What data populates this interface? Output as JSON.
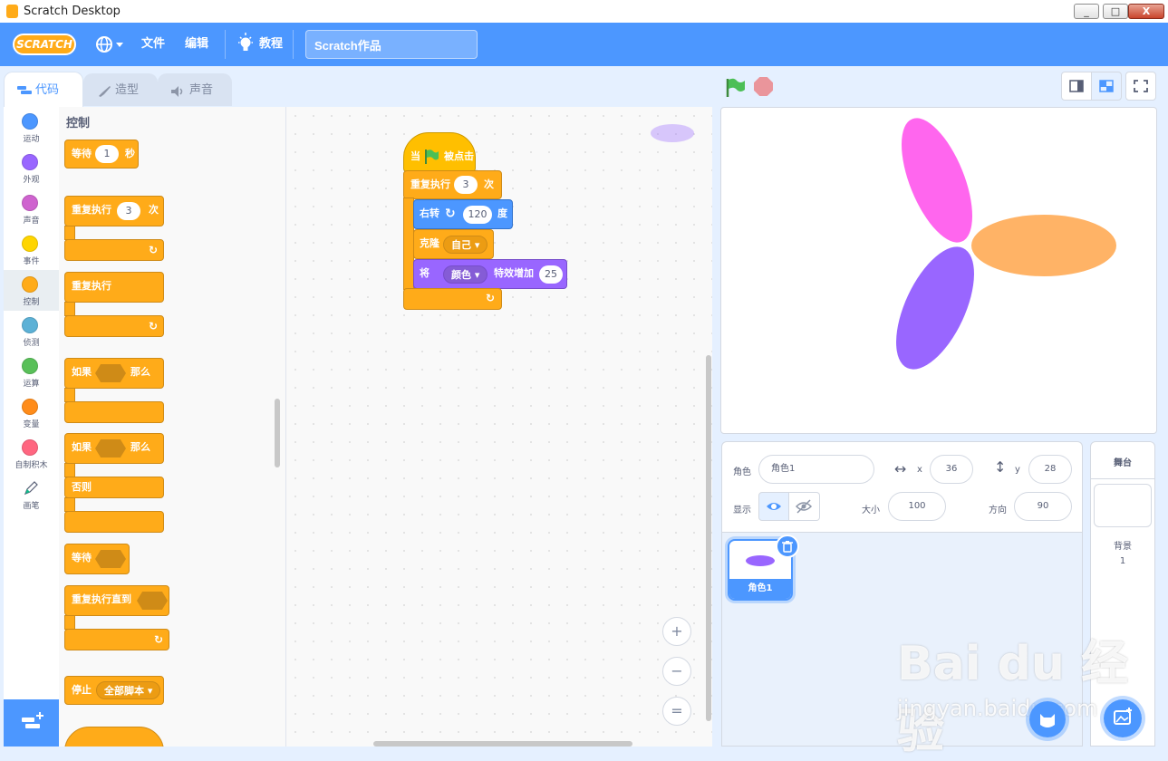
{
  "window": {
    "title": "Scratch Desktop",
    "min": "_",
    "max": "□",
    "close": "X"
  },
  "menubar": {
    "logo": "SCRATCH",
    "file": "文件",
    "edit": "编辑",
    "tutorials": "教程",
    "project_title": "Scratch作品"
  },
  "tabs": {
    "code": "代码",
    "costumes": "造型",
    "sounds": "声音"
  },
  "categories": [
    {
      "label": "运动",
      "color": "#4c97ff"
    },
    {
      "label": "外观",
      "color": "#9966ff"
    },
    {
      "label": "声音",
      "color": "#cf63cf"
    },
    {
      "label": "事件",
      "color": "#ffd500"
    },
    {
      "label": "控制",
      "color": "#ffab19"
    },
    {
      "label": "侦测",
      "color": "#5cb1d6"
    },
    {
      "label": "运算",
      "color": "#59c059"
    },
    {
      "label": "变量",
      "color": "#ff8c1a"
    },
    {
      "label": "自制积木",
      "color": "#ff6680"
    },
    {
      "label": "画笔",
      "color": "#0fbd8c"
    }
  ],
  "palette": {
    "title": "控制",
    "wait": "等待",
    "wait_val": "1",
    "wait_unit": "秒",
    "repeat": "重复执行",
    "repeat_val": "3",
    "repeat_unit": "次",
    "forever": "重复执行",
    "if": "如果",
    "then": "那么",
    "if2": "如果",
    "then2": "那么",
    "else": "否则",
    "wait_until": "等待",
    "repeat_until": "重复执行直到",
    "stop": "停止",
    "stop_opt": "全部脚本"
  },
  "script": {
    "hat": "当",
    "hat_suffix": "被点击",
    "repeat": "重复执行",
    "repeat_val": "3",
    "repeat_unit": "次",
    "turn": "右转",
    "turn_val": "120",
    "turn_unit": "度",
    "clone": "克隆",
    "clone_opt": "自己",
    "effect_pre": "将",
    "effect_opt": "颜色",
    "effect_mid": "特效增加",
    "effect_val": "25"
  },
  "zoom": {
    "in": "+",
    "out": "−",
    "reset": "="
  },
  "sprite_info": {
    "sprite_label": "角色",
    "sprite_name": "角色1",
    "x_label": "x",
    "x_val": "36",
    "y_label": "y",
    "y_val": "28",
    "show_label": "显示",
    "size_label": "大小",
    "size_val": "100",
    "dir_label": "方向",
    "dir_val": "90"
  },
  "sprite_list": {
    "name": "角色1"
  },
  "stage_panel": {
    "title": "舞台",
    "backdrop_label": "背景",
    "backdrop_count": "1"
  },
  "watermark": {
    "main": "Bai du 经验",
    "sub": "jingyan.baidu.com"
  },
  "colors": {
    "accent": "#4c97ff",
    "control": "#ffab19",
    "looks": "#9966ff",
    "motion": "#4c97ff",
    "events": "#ffbf00"
  }
}
